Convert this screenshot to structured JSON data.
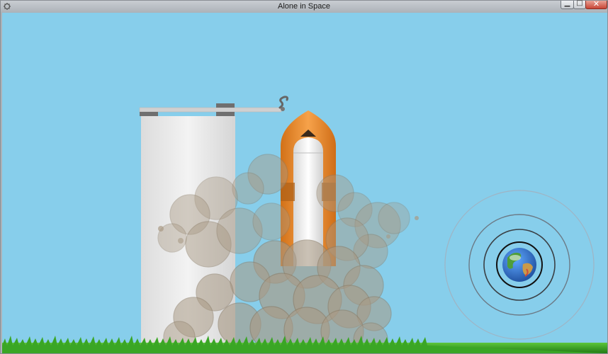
{
  "window": {
    "title": "Alone in Space"
  },
  "icons": {
    "app": "app-icon",
    "minimize": "minimize-icon",
    "maximize": "maximize-icon",
    "close": "close-icon"
  },
  "colors": {
    "sky": "#87ceeb",
    "tower": "#e8e8e8",
    "rocket_orange": "#f0932f",
    "rocket_body": "#f2f2f2",
    "smoke": "#a89a86",
    "grass": "#2f9d1e",
    "earth_ocean": "#2a6fc9"
  }
}
